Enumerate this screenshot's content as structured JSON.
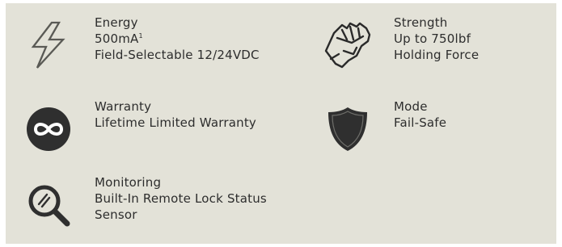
{
  "features": [
    {
      "icon": "lightning-bolt-icon",
      "title": "Energy",
      "lines": [
        "500mA",
        "Field-Selectable 12/24VDC"
      ],
      "footnote": "1"
    },
    {
      "icon": "fist-strength-icon",
      "title": "Strength",
      "lines": [
        "Up to 750lbf",
        "Holding Force"
      ]
    },
    {
      "icon": "infinity-icon",
      "title": "Warranty",
      "lines": [
        "Lifetime Limited Warranty"
      ]
    },
    {
      "icon": "shield-icon",
      "title": "Mode",
      "lines": [
        "Fail-Safe"
      ]
    },
    {
      "icon": "magnifier-icon",
      "title": "Monitoring",
      "lines": [
        "Built-In Remote Lock Status",
        "Sensor"
      ]
    }
  ],
  "colors": {
    "panel": "#e3e2d8",
    "icon_dark": "#2f2f2f",
    "text": "#2d2d2d"
  }
}
